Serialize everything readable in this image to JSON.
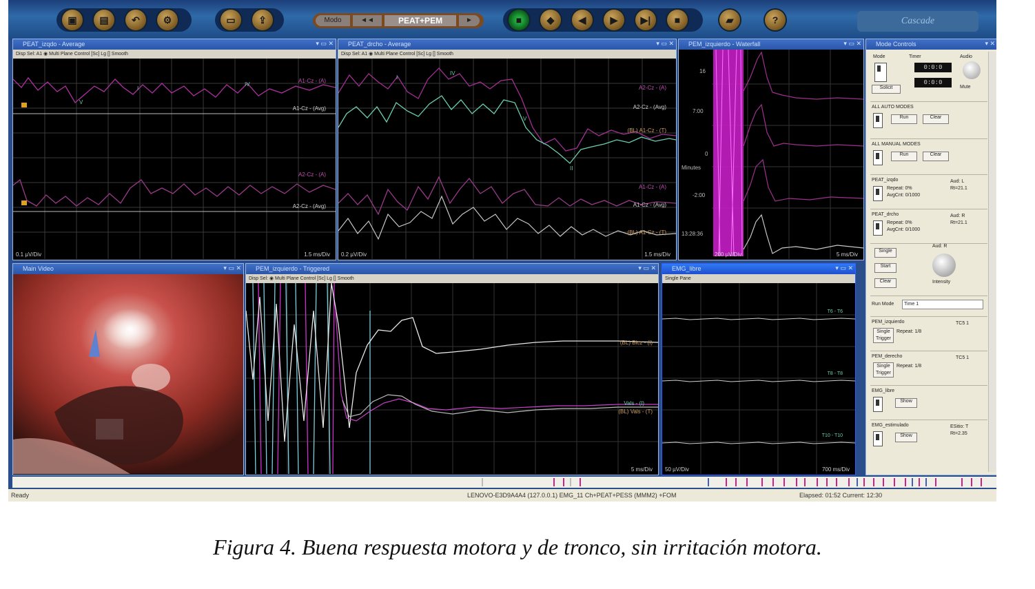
{
  "toolbar": {
    "buttons_left": [
      "save-icon",
      "print-icon",
      "undo-icon",
      "settings-icon"
    ],
    "buttons_mid": [
      "open-icon",
      "export-icon"
    ],
    "montage": {
      "prev": "Modo",
      "ff": "◄◄",
      "label": "PEAT+PEM",
      "next": "►"
    },
    "buttons_right": [
      "record-icon",
      "mark-icon",
      "rewind-icon",
      "play-icon",
      "next-icon",
      "stop-icon"
    ],
    "extra": [
      "folder-icon",
      "help-icon"
    ],
    "brand": "Cascade"
  },
  "panels": {
    "peat_izq": {
      "title": "PEAT_izqdo - Average",
      "tools": "Disp Sel: A1  ◉ Multi Plane Control [Sc] Lg [] Smooth",
      "ch1a": "A1-Cz - (A)",
      "ch1b": "A1-Cz - (Avg)",
      "ch2a": "A2-Cz - (A)",
      "ch2b": "A2-Cz - (Avg)",
      "scale": "0.1 µV/Div",
      "time": "1.5 ms/Div"
    },
    "peat_der": {
      "title": "PEAT_drcho - Average",
      "tools": "Disp Sel: A1  ◉ Multi Plane Control [Sc] Lg [] Smooth",
      "ch1a": "A2-Cz - (A)",
      "ch1b": "A2-Cz - (Avg)",
      "ch1c": "(BL) A1-Cz - (T)",
      "ch2a": "A1-Cz - (A)",
      "ch2b": "A1-Cz - (Avg)",
      "ch2c": "(BL) A1-Cz - (T)",
      "scale": "0.2 µV/Div",
      "time": "1.5 ms/Div"
    },
    "pem_izq_wf": {
      "title": "PEM_izquierdo - Waterfall",
      "y1": "16",
      "y2": "7:00",
      "y3": "0",
      "y4": "-2:00",
      "y5": "13:28:36",
      "ylabel": "Minutes",
      "scale": "200 µV/Div",
      "time": "5 ms/Div"
    },
    "video": {
      "title": "Main Video"
    },
    "pem_izq_trig": {
      "title": "PEM_izquierdo - Triggered",
      "tools": "Disp Sel:  ◉ Multi Plane Control [Sc] Lg [] Smooth",
      "ch1": "(BL) Bicz - (I)",
      "ch2a": "Vals - (I)",
      "ch2b": "(BL) Vals - (T)",
      "time": "5 ms/Div"
    },
    "emg": {
      "title": "EMG_libre",
      "tools": "Single Pane",
      "ch1": "T6 - T6",
      "ch2": "T8 - T8",
      "ch3": "T10 - T10",
      "scale": "50 µV/Div",
      "time": "700 ms/Div"
    },
    "controls": {
      "title": "Mode Controls",
      "mode_label": "Mode",
      "timer_label": "Timer",
      "audio_label": "Audio",
      "timer1": "0:0:0",
      "timer2": "0:0:0",
      "mute": "Mute",
      "solicit": "Solicit",
      "all_auto": "ALL AUTO MODES",
      "all_manual": "ALL MANUAL MODES",
      "btn_run": "Run",
      "btn_clear": "Clear",
      "peat_izq": "PEAT_izqdo",
      "peat_izq_info": "Repeat: 0%",
      "peat_izq_avg": "AvgCnt: 0/1000",
      "peat_izq_side": "Aud: L",
      "peat_izq_rate": "Rt=21.1",
      "peat_der": "PEAT_drcho",
      "peat_der_info": "Repeat: 0%",
      "peat_der_avg": "AvgCnt: 0/1000",
      "peat_der_side": "Aud: R",
      "peat_der_rate": "Rt=21.1",
      "btn_single": "Single",
      "btn_start": "Start",
      "btn_stop": "Clear",
      "knob_label": "Aud: R",
      "intensity": "Intensity",
      "run_mode": "Run Mode",
      "run_mode_value": "Time 1",
      "pem_izq": "PEM_izquierdo",
      "pem_izq_info": "Repeat: 1/8",
      "pem_izq_tc": "TC5 1",
      "pem_der": "PEM_derecho",
      "pem_der_info": "Repeat: 1/8",
      "pem_der_tc": "TC5 1",
      "single_trigger": "Single Trigger",
      "emg_libre": "EMG_libre",
      "btn_show": "Show",
      "emg_est": "EMG_estimulado",
      "emg_est_info": "ESitio: T",
      "emg_est_rate": "Rt=2.35"
    }
  },
  "status": {
    "left": "Ready",
    "center": "LENOVO-E3D9A4A4 (127.0.0.1) EMG_11 Ch+PEAT+PESS (MMM2) +FOM",
    "right": "Elapsed: 01:52  Current: 12:30"
  },
  "caption": "Figura 4. Buena respuesta motora y de tronco, sin irritación motora."
}
